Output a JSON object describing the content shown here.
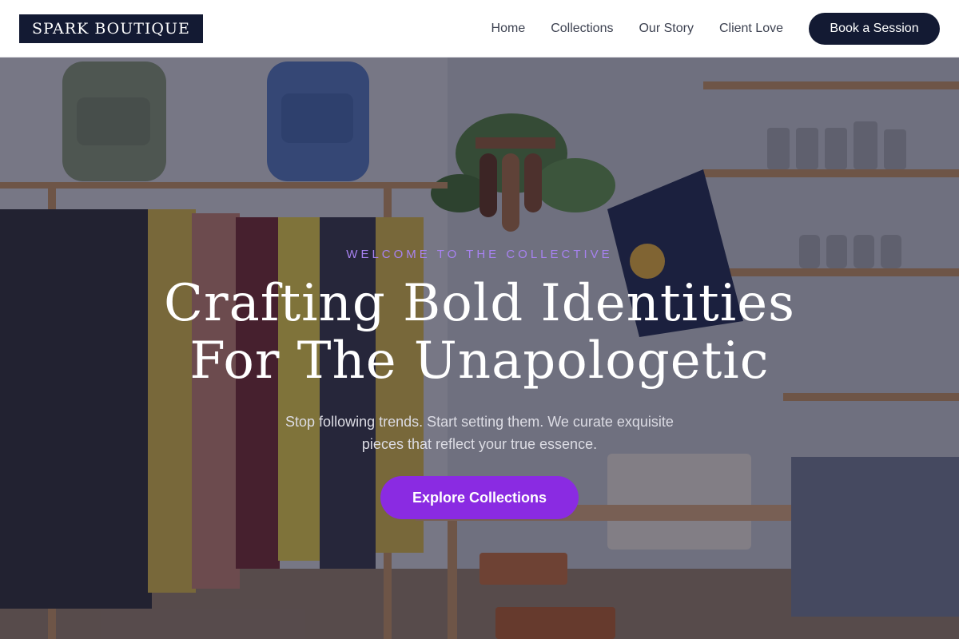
{
  "brand": {
    "logo_text": "SPARK BOUTIQUE"
  },
  "nav": {
    "items": [
      {
        "label": "Home"
      },
      {
        "label": "Collections"
      },
      {
        "label": "Our Story"
      },
      {
        "label": "Client Love"
      }
    ],
    "cta_label": "Book a Session"
  },
  "hero": {
    "eyebrow": "WELCOME TO THE COLLECTIVE",
    "headline_line1": "Crafting Bold Identities",
    "headline_line2": "For The Unapologetic",
    "subtext_line1": "Stop following trends. Start setting them. We curate exquisite",
    "subtext_line2": "pieces that reflect your true essence.",
    "cta_label": "Explore Collections",
    "background_image": "boutique-interior-photo"
  },
  "colors": {
    "header_bg": "#ffffff",
    "brand_navy": "#131a33",
    "accent_purple": "#8a2be2",
    "eyebrow_purple": "#a782f0",
    "nav_text": "#3d4251"
  }
}
